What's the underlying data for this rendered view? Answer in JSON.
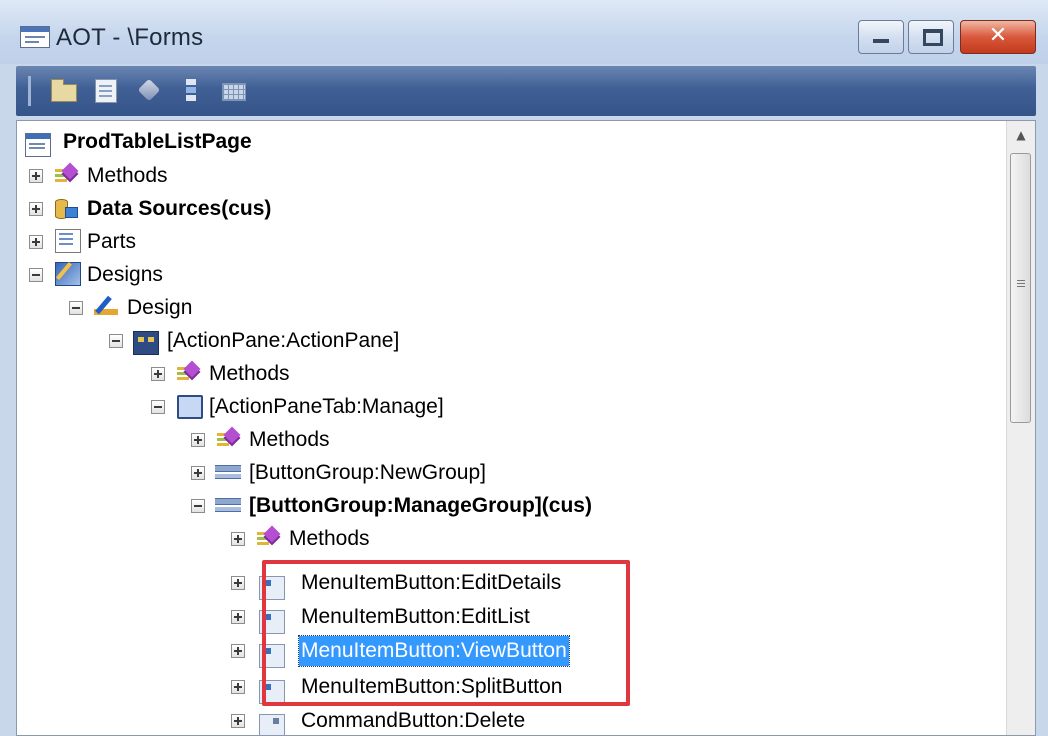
{
  "window": {
    "title": "AOT - \\Forms",
    "close_glyph": "✕"
  },
  "toolbar": {
    "buttons": [
      "open-icon",
      "properties-icon",
      "compile-icon",
      "tree-icon",
      "grid-icon"
    ]
  },
  "tree": {
    "root": "ProdTableListPage",
    "nodes": [
      {
        "label": "Methods",
        "icon": "methods-icon",
        "bold": false
      },
      {
        "label": "Data Sources(cus)",
        "icon": "data-sources-icon",
        "bold": true
      },
      {
        "label": "Parts",
        "icon": "parts-icon",
        "bold": false
      },
      {
        "label": "Designs",
        "icon": "designs-icon",
        "bold": false
      },
      {
        "label": "Design",
        "icon": "design-icon",
        "bold": false
      },
      {
        "label": "[ActionPane:ActionPane]",
        "icon": "action-pane-icon",
        "bold": false
      },
      {
        "label": "Methods",
        "icon": "methods-icon",
        "bold": false
      },
      {
        "label": "[ActionPaneTab:Manage]",
        "icon": "action-pane-tab-icon",
        "bold": false
      },
      {
        "label": "Methods",
        "icon": "methods-icon",
        "bold": false
      },
      {
        "label": "[ButtonGroup:NewGroup]",
        "icon": "button-group-icon",
        "bold": false
      },
      {
        "label": "[ButtonGroup:ManageGroup](cus)",
        "icon": "button-group-icon",
        "bold": true
      },
      {
        "label": "Methods",
        "icon": "methods-icon",
        "bold": false
      },
      {
        "label": "MenuItemButton:EditDetails",
        "icon": "menu-item-button-icon",
        "bold": false
      },
      {
        "label": "MenuItemButton:EditList",
        "icon": "menu-item-button-icon",
        "bold": false
      },
      {
        "label": "MenuItemButton:ViewButton",
        "icon": "menu-item-button-icon",
        "bold": false,
        "selected": true
      },
      {
        "label": "MenuItemButton:SplitButton",
        "icon": "menu-item-button-icon",
        "bold": false
      },
      {
        "label": "CommandButton:Delete",
        "icon": "command-button-icon",
        "bold": false
      }
    ]
  },
  "scrollbar": {
    "up_glyph": "▲"
  },
  "colors": {
    "selection": "#3399ff",
    "highlight_box": "#e0373f",
    "toolbar": "#3f5f95"
  }
}
